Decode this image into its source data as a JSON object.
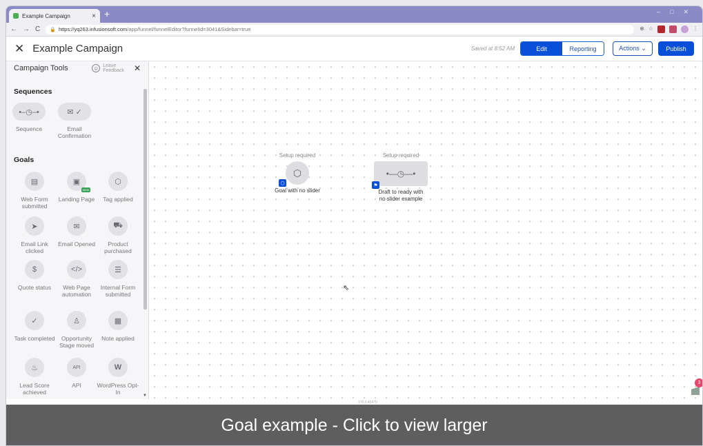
{
  "browser": {
    "tab_title": "Example Campaign",
    "tab_close": "×",
    "new_tab": "+",
    "url_host": "https://yq263.infusionsoft.com",
    "url_path": "/app/funnel/funnelEditor?funnelId=3041&Sidebar=true",
    "nav_back": "←",
    "nav_forward": "→",
    "nav_reload": "C"
  },
  "header": {
    "close": "✕",
    "title": "Example Campaign",
    "saved": "Saved at 8:52 AM",
    "edit": "Edit",
    "reporting": "Reporting",
    "actions": "Actions ⌄",
    "publish": "Publish"
  },
  "sidebar": {
    "title": "Campaign Tools",
    "feedback_line1": "Leave",
    "feedback_line2": "Feedback",
    "close": "✕",
    "sections": {
      "sequences": "Sequences",
      "goals": "Goals"
    },
    "sequences": [
      {
        "label": "Sequence",
        "icon": "sequence-icon"
      },
      {
        "label": "Email Confirmation",
        "icon": "email-confirm-icon"
      }
    ],
    "goals": [
      {
        "label": "Web Form submitted",
        "icon": "web-form-icon"
      },
      {
        "label": "Landing Page",
        "icon": "landing-page-icon",
        "badge": "NEW"
      },
      {
        "label": "Tag applied",
        "icon": "tag-icon"
      },
      {
        "label": "Email Link clicked",
        "icon": "cursor-icon"
      },
      {
        "label": "Email Opened",
        "icon": "envelope-open-icon"
      },
      {
        "label": "Product purchased",
        "icon": "cart-icon"
      },
      {
        "label": "Quote status",
        "icon": "dollar-icon"
      },
      {
        "label": "Web Page automation",
        "icon": "code-icon"
      },
      {
        "label": "Internal Form submitted",
        "icon": "form-icon"
      },
      {
        "label": "Task completed",
        "icon": "check-icon"
      },
      {
        "label": "Opportunity Stage moved",
        "icon": "opportunity-icon"
      },
      {
        "label": "Note applied",
        "icon": "note-icon"
      },
      {
        "label": "Lead Score achieved",
        "icon": "flame-icon"
      },
      {
        "label": "API",
        "icon": "api-icon"
      },
      {
        "label": "WordPress Opt-In",
        "icon": "wordpress-icon"
      }
    ]
  },
  "canvas": {
    "goal_node": {
      "status": "Setup required",
      "name": "Goal with no slider"
    },
    "sequence_node": {
      "status": "Setup required",
      "name_line1": "Draft to ready with",
      "name_line2": "no slider example"
    },
    "notification_count": "3",
    "coords": "170,0.45470"
  },
  "caption": "Goal example - Click to view larger",
  "colors": {
    "primary": "#0a4fd8",
    "tab_bar": "#8a8ac7",
    "caption_bg": "#5e5e5f",
    "badge_pink": "#e8456b"
  }
}
